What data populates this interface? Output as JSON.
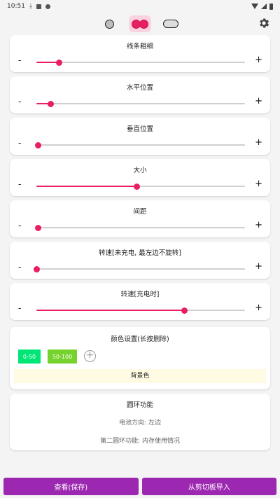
{
  "status_bar": {
    "time": "10:51"
  },
  "style_options": [
    "single-dot",
    "double-dot",
    "pill"
  ],
  "sliders": [
    {
      "title": "线条粗细",
      "minus": "-",
      "plus": "+",
      "level": 0.11
    },
    {
      "title": "水平位置",
      "minus": "-",
      "plus": "+",
      "level": 0.07
    },
    {
      "title": "垂直位置",
      "minus": "-",
      "plus": "+",
      "level": 0.01
    },
    {
      "title": "大小",
      "minus": "-",
      "plus": "+",
      "level": 0.48
    },
    {
      "title": "间距",
      "minus": "-",
      "plus": "+",
      "level": 0.01
    },
    {
      "title": "转速[未充电, 最左边不旋转]",
      "minus": "-",
      "plus": "+",
      "level": 0.0
    },
    {
      "title": "转速[充电时]",
      "minus": "-",
      "plus": "+",
      "level": 0.71
    }
  ],
  "color_settings": {
    "title": "颜色设置(长按删除)",
    "chips": [
      {
        "label": "0-50",
        "color": "#00e676"
      },
      {
        "label": "50-100",
        "color": "#76d32d"
      }
    ],
    "add_symbol": "+",
    "background_label": "背景色"
  },
  "loop": {
    "title": "圆环功能",
    "battery_direction": "电池方向: 左边",
    "second_loop": "第二圆环功能: 内存使用情况"
  },
  "bottom": {
    "save_label": "查看(保存)",
    "import_label": "从剪切板导入"
  },
  "colors": {
    "accent": "#e91e63",
    "bottom_button": "#9c27b0"
  }
}
